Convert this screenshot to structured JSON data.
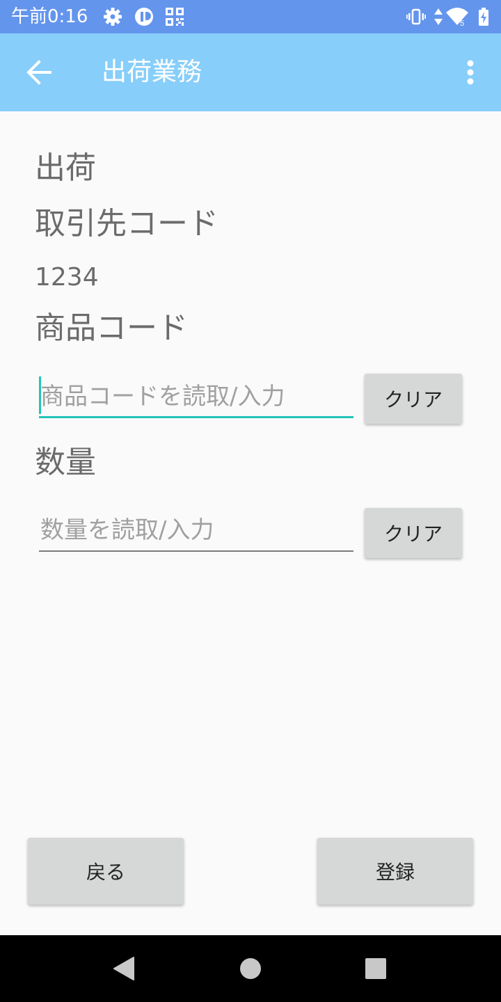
{
  "status_bar": {
    "time": "午前0:16",
    "left_icons": [
      "gear-icon",
      "app-badge-icon",
      "qr-code-icon"
    ],
    "right_icons": [
      "vibrate-icon",
      "data-arrows-icon",
      "wifi-icon",
      "battery-charging-icon"
    ],
    "wifi_badge": "5"
  },
  "app_bar": {
    "title": "出荷業務",
    "back_icon": "arrow-left-icon",
    "menu_icon": "more-vert-icon"
  },
  "screen": {
    "heading": "出荷",
    "customer_code_label": "取引先コード",
    "customer_code_value": "1234",
    "product_code_label": "商品コード",
    "product_code_input": {
      "value": "",
      "placeholder": "商品コードを読取/入力"
    },
    "product_clear_label": "クリア",
    "quantity_label": "数量",
    "quantity_input": {
      "value": "",
      "placeholder": "数量を読取/入力"
    },
    "quantity_clear_label": "クリア"
  },
  "footer": {
    "back_label": "戻る",
    "register_label": "登録"
  },
  "nav_bar": {
    "icons": [
      "nav-back-icon",
      "nav-home-icon",
      "nav-recents-icon"
    ]
  },
  "colors": {
    "status_bar": "#6495ed",
    "app_bar": "#87cefa",
    "focus_accent": "#20c5b8",
    "button": "#d6d7d7"
  }
}
